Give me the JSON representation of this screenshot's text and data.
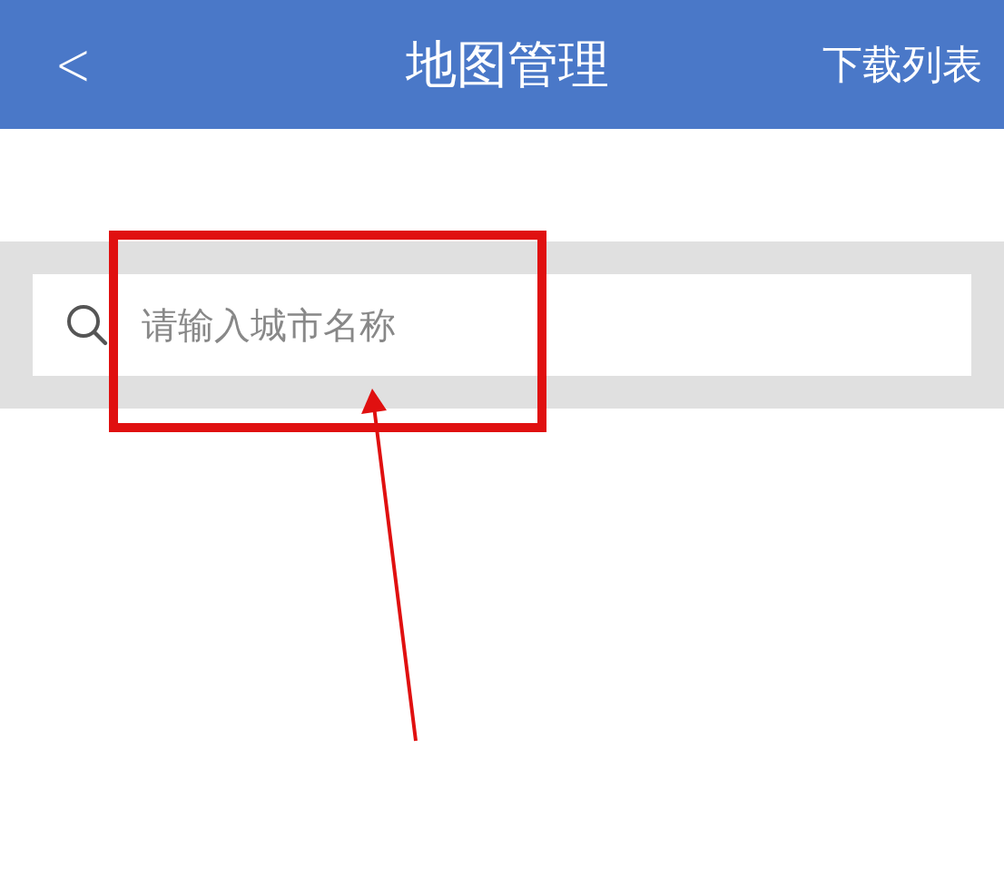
{
  "header": {
    "back": "<",
    "title": "地图管理",
    "action": "下载列表"
  },
  "search": {
    "placeholder": "请输入城市名称"
  },
  "annotations": {
    "highlight_box": true,
    "arrow": true
  }
}
